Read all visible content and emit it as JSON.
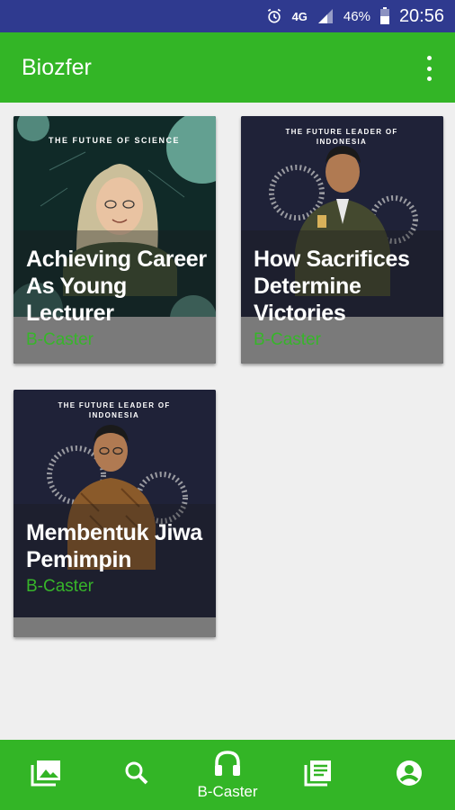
{
  "status_bar": {
    "network": "4G",
    "battery": "46%",
    "time": "20:56",
    "color": "#2f3a8f"
  },
  "app_bar": {
    "title": "Biozfer",
    "color": "#33b526",
    "menu_icon": "more-vert-icon"
  },
  "cards": [
    {
      "title": "Achieving Career As Young Lecturer",
      "category": "B-Caster",
      "poster_heading": "THE FUTURE OF SCIENCE"
    },
    {
      "title": "How Sacrifices Determine Victories",
      "category": "B-Caster",
      "poster_heading_1": "THE FUTURE LEADER OF",
      "poster_heading_2": "INDONESIA"
    },
    {
      "title": "Membentuk Jiwa Pemimpin",
      "category": "B-Caster",
      "poster_heading_1": "THE FUTURE LEADER OF",
      "poster_heading_2": "INDONESIA"
    }
  ],
  "bottom_nav": {
    "items": [
      {
        "icon": "gallery-icon",
        "label": ""
      },
      {
        "icon": "search-icon",
        "label": ""
      },
      {
        "icon": "headphones-icon",
        "label": "B-Caster",
        "active": true
      },
      {
        "icon": "articles-icon",
        "label": ""
      },
      {
        "icon": "account-icon",
        "label": ""
      }
    ]
  }
}
